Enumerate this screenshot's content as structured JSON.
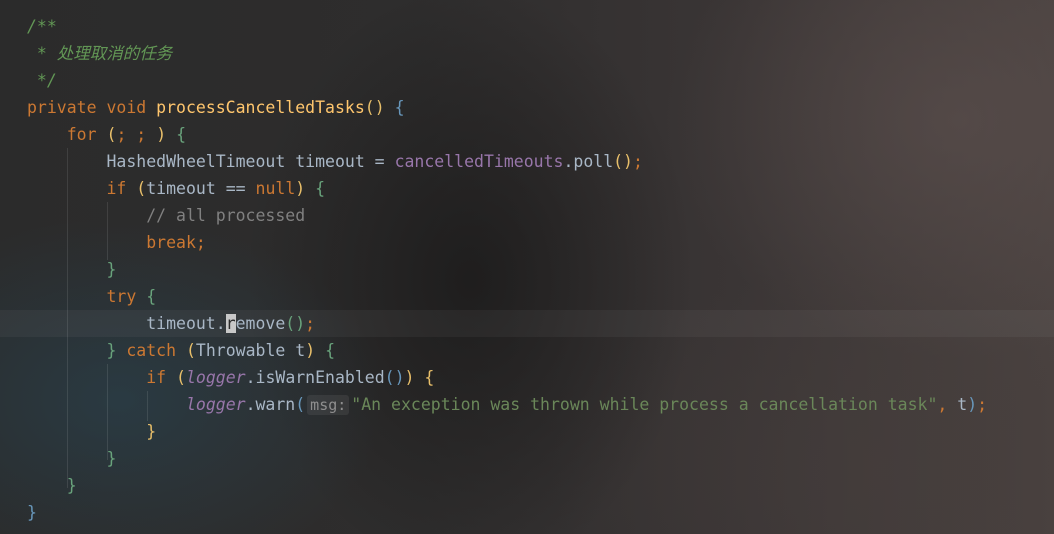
{
  "editor": {
    "lines": [
      [
        {
          "c": "comment-doc",
          "t": "/**"
        }
      ],
      [
        {
          "c": "comment-doc",
          "t": " * 处理取消的任务"
        }
      ],
      [
        {
          "c": "comment-doc",
          "t": " */"
        }
      ],
      [
        {
          "c": "kw",
          "t": "private void "
        },
        {
          "c": "method",
          "t": "processCancelledTasks"
        },
        {
          "c": "p1",
          "t": "()"
        },
        {
          "c": "plain",
          "t": " "
        },
        {
          "c": "p2",
          "t": "{"
        }
      ],
      [
        {
          "c": "plain",
          "t": "    "
        },
        {
          "c": "kw",
          "t": "for "
        },
        {
          "c": "p1",
          "t": "("
        },
        {
          "c": "kw",
          "t": "; ; "
        },
        {
          "c": "p1",
          "t": ")"
        },
        {
          "c": "plain",
          "t": " "
        },
        {
          "c": "p3",
          "t": "{"
        }
      ],
      [
        {
          "c": "plain",
          "t": "        HashedWheelTimeout timeout = "
        },
        {
          "c": "field",
          "t": "cancelledTimeouts"
        },
        {
          "c": "plain",
          "t": ".poll"
        },
        {
          "c": "p1",
          "t": "()"
        },
        {
          "c": "kw",
          "t": ";"
        }
      ],
      [
        {
          "c": "plain",
          "t": "        "
        },
        {
          "c": "kw",
          "t": "if "
        },
        {
          "c": "p1",
          "t": "("
        },
        {
          "c": "plain",
          "t": "timeout == "
        },
        {
          "c": "kw",
          "t": "null"
        },
        {
          "c": "p1",
          "t": ")"
        },
        {
          "c": "plain",
          "t": " "
        },
        {
          "c": "p3",
          "t": "{"
        }
      ],
      [
        {
          "c": "plain",
          "t": "            "
        },
        {
          "c": "comment",
          "t": "// all processed"
        }
      ],
      [
        {
          "c": "plain",
          "t": "            "
        },
        {
          "c": "kw",
          "t": "break;"
        }
      ],
      [
        {
          "c": "plain",
          "t": "        "
        },
        {
          "c": "p3",
          "t": "}"
        }
      ],
      [
        {
          "c": "plain",
          "t": "        "
        },
        {
          "c": "kw",
          "t": "try "
        },
        {
          "c": "p3",
          "t": "{"
        }
      ],
      [
        {
          "c": "plain",
          "t": "            timeout."
        },
        {
          "c": "caret-char",
          "t": "r"
        },
        {
          "c": "plain",
          "t": "emove"
        },
        {
          "c": "p3",
          "t": "()"
        },
        {
          "c": "kw",
          "t": ";"
        }
      ],
      [
        {
          "c": "plain",
          "t": "        "
        },
        {
          "c": "p3",
          "t": "}"
        },
        {
          "c": "plain",
          "t": " "
        },
        {
          "c": "kw",
          "t": "catch "
        },
        {
          "c": "p1",
          "t": "("
        },
        {
          "c": "plain",
          "t": "Throwable t"
        },
        {
          "c": "p1",
          "t": ")"
        },
        {
          "c": "plain",
          "t": " "
        },
        {
          "c": "p3",
          "t": "{"
        }
      ],
      [
        {
          "c": "plain",
          "t": "            "
        },
        {
          "c": "kw",
          "t": "if "
        },
        {
          "c": "p1",
          "t": "("
        },
        {
          "c": "italic-field",
          "t": "logger"
        },
        {
          "c": "plain",
          "t": ".isWarnEnabled"
        },
        {
          "c": "p2",
          "t": "()"
        },
        {
          "c": "p1",
          "t": ")"
        },
        {
          "c": "plain",
          "t": " "
        },
        {
          "c": "p1",
          "t": "{"
        }
      ],
      [
        {
          "c": "plain",
          "t": "                "
        },
        {
          "c": "italic-field",
          "t": "logger"
        },
        {
          "c": "plain",
          "t": ".warn"
        },
        {
          "c": "p2",
          "t": "("
        },
        {
          "c": "hint",
          "t": "msg:"
        },
        {
          "c": "str",
          "t": "\"An exception was thrown while process a cancellation task\""
        },
        {
          "c": "kw",
          "t": ", "
        },
        {
          "c": "plain",
          "t": "t"
        },
        {
          "c": "p2",
          "t": ")"
        },
        {
          "c": "kw",
          "t": ";"
        }
      ],
      [
        {
          "c": "plain",
          "t": "            "
        },
        {
          "c": "p1",
          "t": "}"
        }
      ],
      [
        {
          "c": "plain",
          "t": "        "
        },
        {
          "c": "p3",
          "t": "}"
        }
      ],
      [
        {
          "c": "plain",
          "t": "    "
        },
        {
          "c": "p3",
          "t": "}"
        }
      ],
      [
        {
          "c": "p2",
          "t": "}"
        }
      ]
    ]
  }
}
